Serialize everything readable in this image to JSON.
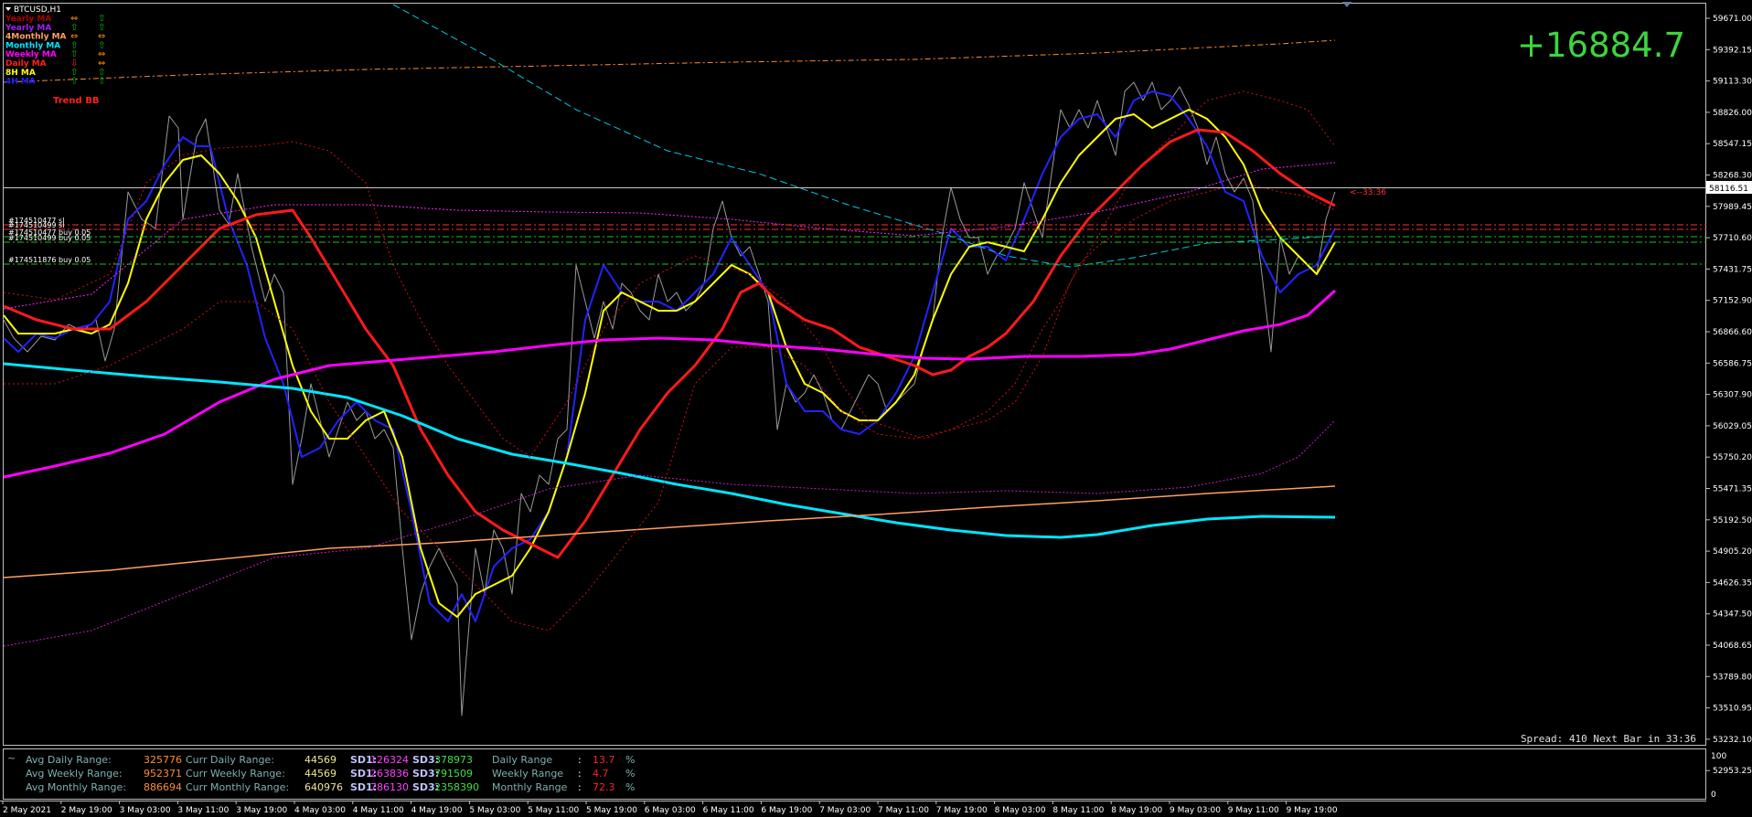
{
  "window": {
    "symbol_title": "BTCUSD,H1",
    "menu_arrow": "triangle-down-icon"
  },
  "profit_display": {
    "value": "+16884.7",
    "color": "#3fd43f"
  },
  "legend": [
    {
      "name": "Yearly MA",
      "color": "#b00000",
      "arrow1": "⇔",
      "arrow1_color": "#ff8c00",
      "arrow2": "⇧",
      "arrow2_color": "#00c000"
    },
    {
      "name": "Yearly MA",
      "color": "#a020f0",
      "arrow1": "⇧",
      "arrow1_color": "#00c000",
      "arrow2": "⇧",
      "arrow2_color": "#00c000"
    },
    {
      "name": "4Monthly MA",
      "color": "#ffa060",
      "arrow1": "⇔",
      "arrow1_color": "#ff8c00",
      "arrow2": "⇔",
      "arrow2_color": "#ff8c00"
    },
    {
      "name": "Monthly MA",
      "color": "#00e5ff",
      "arrow1": "⇧",
      "arrow1_color": "#00c000",
      "arrow2": "⇧",
      "arrow2_color": "#00c000"
    },
    {
      "name": "Weekly MA",
      "color": "#ff00ff",
      "arrow1": "⇧",
      "arrow1_color": "#00c000",
      "arrow2": "⇔",
      "arrow2_color": "#ff8c00"
    },
    {
      "name": "Daily MA",
      "color": "#ff2020",
      "arrow1": "⇩",
      "arrow1_color": "#ff2020",
      "arrow2": "⇔",
      "arrow2_color": "#ff8c00"
    },
    {
      "name": "8H MA",
      "color": "#ffff00",
      "arrow1": "⇧",
      "arrow1_color": "#00c000",
      "arrow2": "⇧",
      "arrow2_color": "#00c000"
    },
    {
      "name": "4H MA",
      "color": "#2020ff",
      "arrow1": "⇧",
      "arrow1_color": "#00c000",
      "arrow2": "⇧",
      "arrow2_color": "#00c000"
    }
  ],
  "trend_label": "Trend BB",
  "trend_color": "#ff2020",
  "price_axis": [
    "59671.00",
    "59392.15",
    "59113.30",
    "58826.00",
    "58547.15",
    "58268.30",
    "57989.45",
    "57710.60",
    "57431.75",
    "57152.90",
    "56866.60",
    "56586.75",
    "56307.90",
    "56029.05",
    "55750.20",
    "55471.35",
    "55192.50",
    "54905.20",
    "54626.35",
    "54347.50",
    "54068.65",
    "53789.80",
    "53510.95",
    "53232.10",
    "52953.25"
  ],
  "current_price": "58116.51",
  "bar_timer": "<--33:36",
  "orders": [
    {
      "label": "#174510477 sl",
      "color": "#ff3030"
    },
    {
      "label": "#174510499 sl",
      "color": "#ff3030"
    },
    {
      "label": "#174510477 buy 0.05",
      "color": "#20c020"
    },
    {
      "label": "#174510499 buy 0.05",
      "color": "#20c020"
    },
    {
      "label": "#174511876 buy 0.05",
      "color": "#20c020"
    }
  ],
  "spread_text": "Spread: 410 Next Bar in 33:36",
  "ranges": {
    "rows": [
      {
        "label": "Avg Daily Range:",
        "value": "325776",
        "curr_label": "Curr Daily Range:",
        "curr_value": "44569",
        "sd1_label": "SD1:",
        "sd1": "126324",
        "sd3_label": "SD3:",
        "sd3": "378973",
        "range_label": "Daily Range",
        "colon": ":",
        "pct": "13.7",
        "pct_sign": "%"
      },
      {
        "label": "Avg Weekly Range:",
        "value": "952371",
        "curr_label": "Curr Weekly Range:",
        "curr_value": "44569",
        "sd1_label": "SD1:",
        "sd1": "263836",
        "sd3_label": "SD3:",
        "sd3": "791509",
        "range_label": "Weekly Range",
        "colon": ":",
        "pct": "4.7",
        "pct_sign": "%"
      },
      {
        "label": "Avg Monthly Range:",
        "value": "886694",
        "curr_label": "Curr Monthly Range:",
        "curr_value": "640976",
        "sd1_label": "SD1:",
        "sd1": "786130",
        "sd3_label": "SD3:",
        "sd3": "2358390",
        "range_label": "Monthly Range",
        "colon": ":",
        "pct": "72.3",
        "pct_sign": "%"
      }
    ],
    "tilde": "~"
  },
  "sub_axis": {
    "top": "100",
    "bottom": "0"
  },
  "time_axis": [
    "2 May 2021",
    "2 May 19:00",
    "3 May 03:00",
    "3 May 11:00",
    "3 May 19:00",
    "4 May 03:00",
    "4 May 11:00",
    "4 May 19:00",
    "5 May 03:00",
    "5 May 11:00",
    "5 May 19:00",
    "6 May 03:00",
    "6 May 11:00",
    "6 May 19:00",
    "7 May 03:00",
    "7 May 11:00",
    "7 May 19:00",
    "8 May 03:00",
    "8 May 11:00",
    "8 May 19:00",
    "9 May 03:00",
    "9 May 11:00",
    "9 May 19:00"
  ]
}
